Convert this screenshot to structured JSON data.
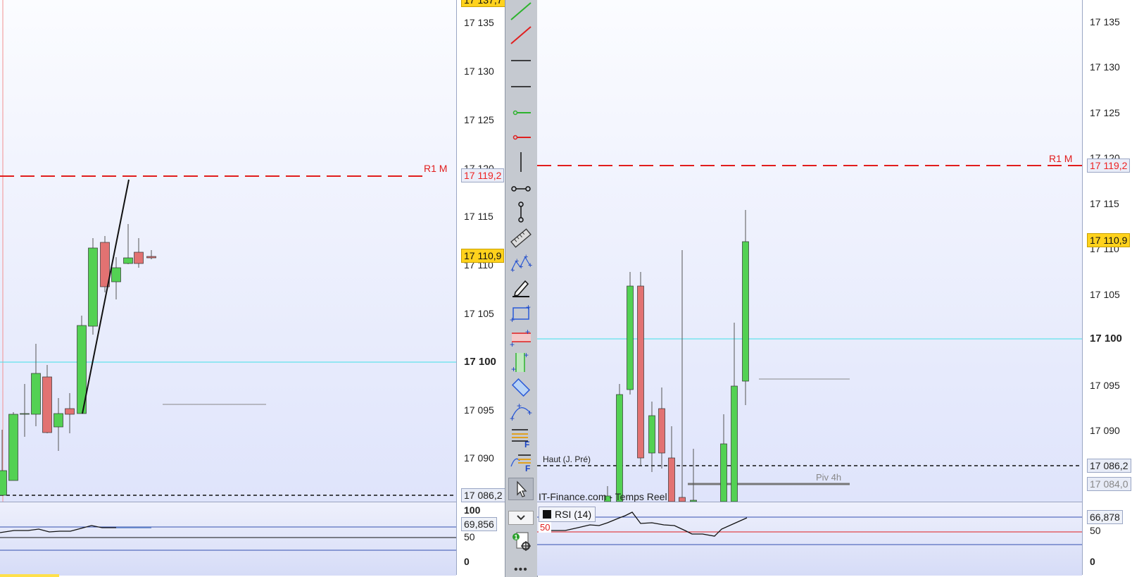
{
  "left_chart": {
    "price_axis": {
      "ticks": [
        "17 135",
        "17 130",
        "17 125",
        "17 120",
        "17 115",
        "17 110",
        "17 105",
        "17 100",
        "17 095",
        "17 090"
      ],
      "bold_tick": "17 100",
      "top_partial": "17 137,7",
      "r1_label": "17 119,2",
      "current_label": "17 110,9",
      "haut_label": "17 086,2"
    },
    "r1_text": "R1 M",
    "rsi_axis": {
      "label_100": "100",
      "label_50": "50",
      "label_0": "0",
      "value": "69,856"
    }
  },
  "right_chart": {
    "price_axis": {
      "ticks": [
        "17 135",
        "17 130",
        "17 125",
        "17 120",
        "17 115",
        "17 110",
        "17 105",
        "17 100",
        "17 095",
        "17 090"
      ],
      "bold_tick": "17 100",
      "r1_label": "17 119,2",
      "current_label": "17 110,9",
      "haut_label": "17 086,2",
      "piv_label": "17 084,0"
    },
    "r1_text": "R1 M",
    "haut_text": "Haut (J. Pré)",
    "piv_text": "Piv 4h",
    "source_text": "IT-Finance.com - Temps Reel",
    "rsi_title": "RSI (14)",
    "rsi_level_50": "50",
    "rsi_axis": {
      "label_50": "50",
      "label_0": "0",
      "value": "66,878"
    }
  },
  "toolbar": {
    "tools": [
      "trendline-green-icon",
      "trendline-red-icon",
      "horizontal-line-icon",
      "horizontal-line-2-icon",
      "half-line-green-icon",
      "half-line-red-icon",
      "vertical-line-icon",
      "segment-icon",
      "vertical-segment-icon",
      "ruler-icon",
      "multi-point-icon",
      "pencil-icon",
      "rectangle-icon",
      "horizontal-channel-icon",
      "vertical-channel-icon",
      "diagonal-rectangle-icon",
      "curve-icon",
      "fibonacci-icon",
      "fibonacci-fan-icon",
      "cursor-icon"
    ],
    "more": "•••"
  },
  "colors": {
    "bull": "#53d153",
    "bear": "#e27272",
    "r1": "#e11d1d",
    "cyan": "#41e0e8",
    "current_bg": "#ffd21c"
  }
}
